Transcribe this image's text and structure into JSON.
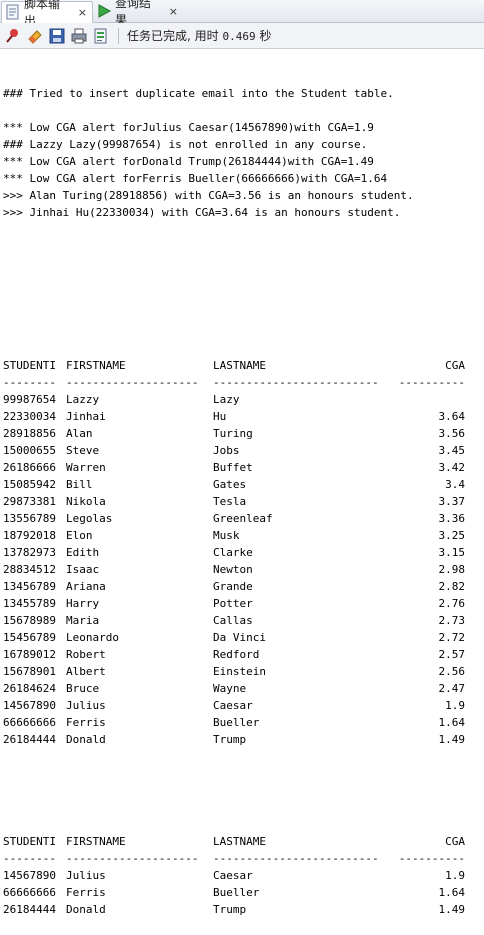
{
  "tabs": [
    {
      "label": "脚本输出",
      "close": "×"
    },
    {
      "label": "查询结果",
      "close": "×"
    }
  ],
  "toolbar": {
    "status_prefix": "任务已完成,  用时 ",
    "time_value": "0.469",
    "time_unit": " 秒"
  },
  "messages": [
    "### Tried to insert duplicate email into the Student table.",
    "",
    "*** Low CGA alert forJulius Caesar(14567890)with CGA=1.9",
    "### Lazzy Lazy(99987654) is not enrolled in any course.",
    "*** Low CGA alert forDonald Trump(26184444)with CGA=1.49",
    "*** Low CGA alert forFerris Bueller(66666666)with CGA=1.64",
    ">>> Alan Turing(28918856) with CGA=3.56 is an honours student.",
    ">>> Jinhai Hu(22330034) with CGA=3.64 is an honours student."
  ],
  "table1": {
    "headers": [
      "STUDENTI",
      "FIRSTNAME",
      "LASTNAME",
      "CGA"
    ],
    "separators": [
      "--------",
      "--------------------",
      "-------------------------",
      "----------"
    ],
    "rows": [
      [
        "99987654",
        "Lazzy",
        "Lazy",
        ""
      ],
      [
        "22330034",
        "Jinhai",
        "Hu",
        "3.64"
      ],
      [
        "28918856",
        "Alan",
        "Turing",
        "3.56"
      ],
      [
        "15000655",
        "Steve",
        "Jobs",
        "3.45"
      ],
      [
        "26186666",
        "Warren",
        "Buffet",
        "3.42"
      ],
      [
        "15085942",
        "Bill",
        "Gates",
        "3.4"
      ],
      [
        "29873381",
        "Nikola",
        "Tesla",
        "3.37"
      ],
      [
        "13556789",
        "Legolas",
        "Greenleaf",
        "3.36"
      ],
      [
        "18792018",
        "Elon",
        "Musk",
        "3.25"
      ],
      [
        "13782973",
        "Edith",
        "Clarke",
        "3.15"
      ],
      [
        "28834512",
        "Isaac",
        "Newton",
        "2.98"
      ],
      [
        "13456789",
        "Ariana",
        "Grande",
        "2.82"
      ],
      [
        "13455789",
        "Harry",
        "Potter",
        "2.76"
      ],
      [
        "15678989",
        "Maria",
        "Callas",
        "2.73"
      ],
      [
        "15456789",
        "Leonardo",
        "Da Vinci",
        "2.72"
      ],
      [
        "16789012",
        "Robert",
        "Redford",
        "2.57"
      ],
      [
        "15678901",
        "Albert",
        "Einstein",
        "2.56"
      ],
      [
        "26184624",
        "Bruce",
        "Wayne",
        "2.47"
      ],
      [
        "14567890",
        "Julius",
        "Caesar",
        "1.9"
      ],
      [
        "66666666",
        "Ferris",
        "Bueller",
        "1.64"
      ],
      [
        "26184444",
        "Donald",
        "Trump",
        "1.49"
      ]
    ]
  },
  "table2": {
    "headers": [
      "STUDENTI",
      "FIRSTNAME",
      "LASTNAME",
      "CGA"
    ],
    "separators": [
      "--------",
      "--------------------",
      "-------------------------",
      "----------"
    ],
    "rows": [
      [
        "14567890",
        "Julius",
        "Caesar",
        "1.9"
      ],
      [
        "66666666",
        "Ferris",
        "Bueller",
        "1.64"
      ],
      [
        "26184444",
        "Donald",
        "Trump",
        "1.49"
      ]
    ]
  },
  "colors": {
    "accent_red": "#cc2a2a",
    "accent_green": "#2e9a3a"
  },
  "icons": [
    "script-output-icon",
    "run-query-icon",
    "pin-icon",
    "eraser-icon",
    "save-icon",
    "print-icon",
    "export-icon"
  ]
}
